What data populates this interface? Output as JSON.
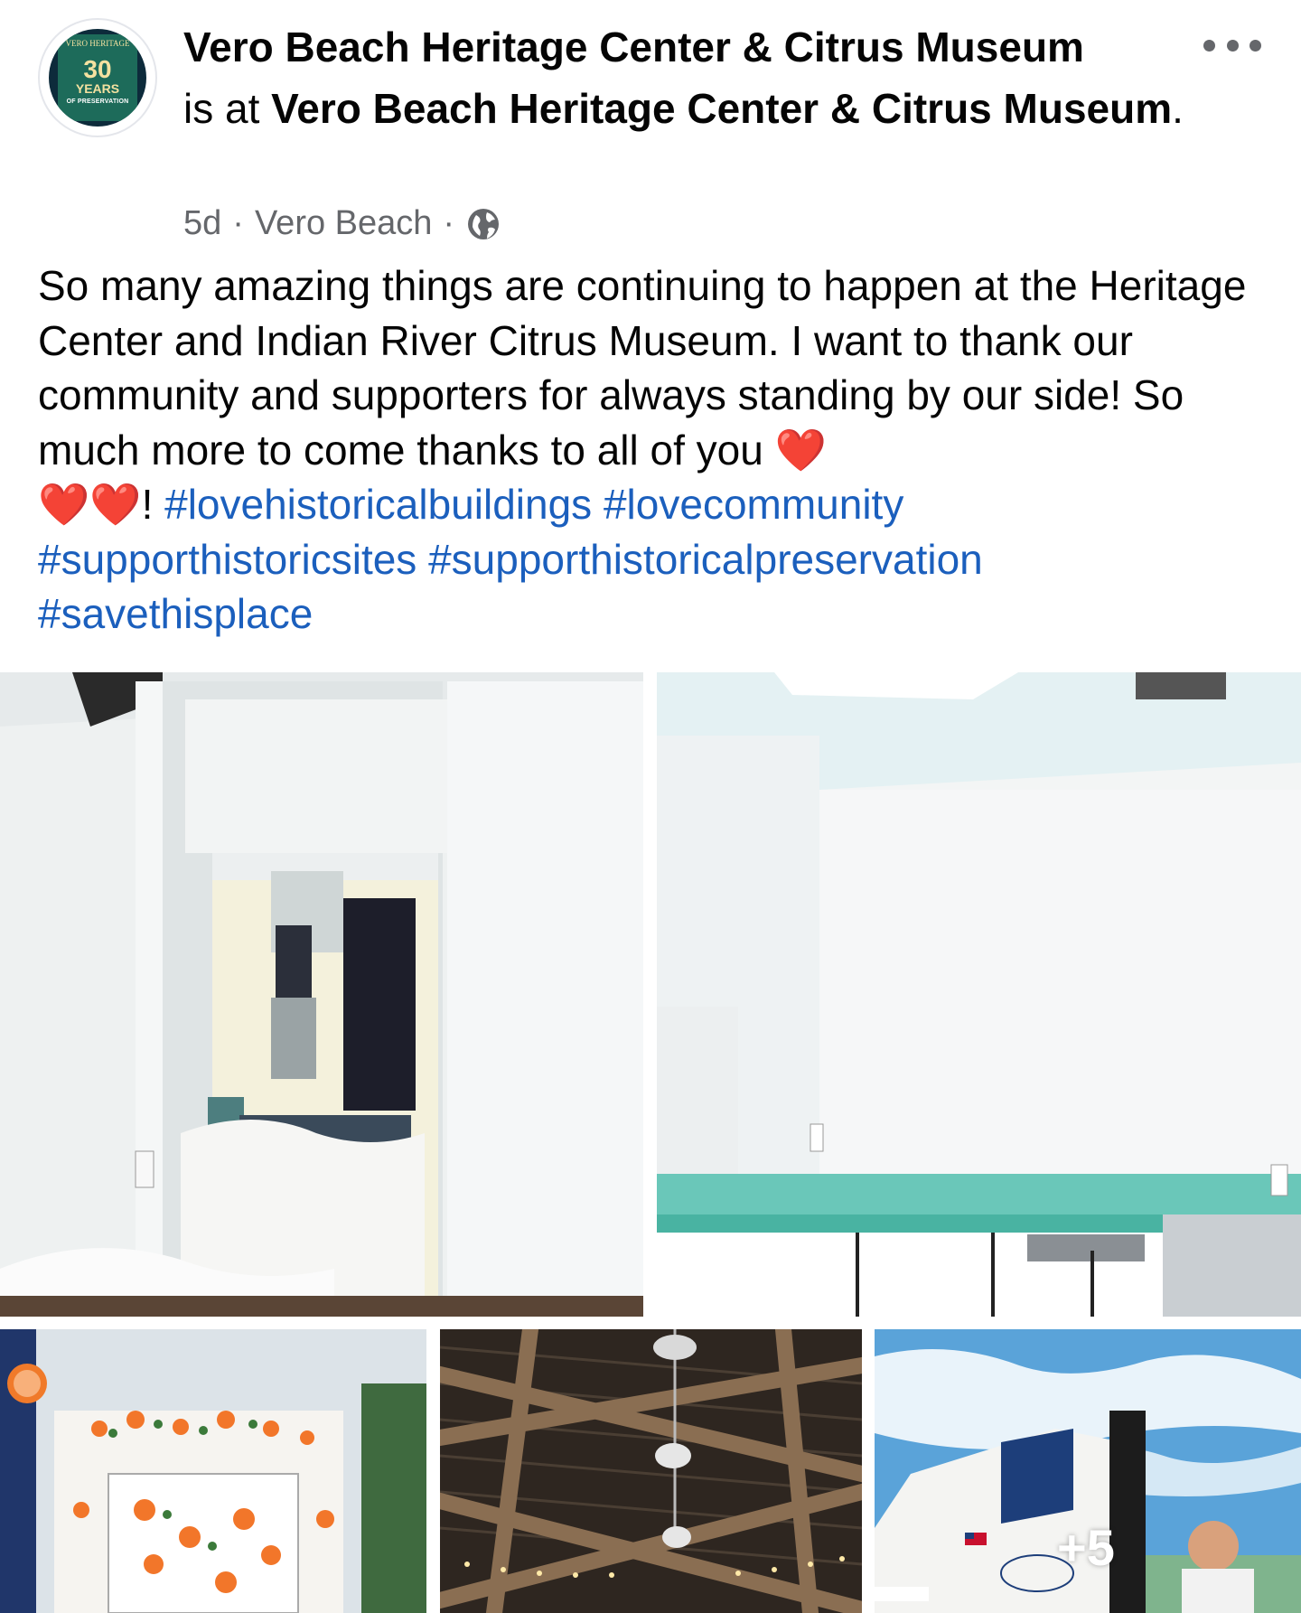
{
  "header": {
    "page_name": "Vero Beach Heritage Center & Citrus Museum",
    "is_at_text": "is at",
    "location_name": "Vero Beach Heritage Center & Citrus Museum",
    "period": ".",
    "more_icon": "more-horizontal-icon"
  },
  "avatar": {
    "logo_top": "VERO HERITAGE",
    "logo_number": "30",
    "logo_years": "YEARS",
    "logo_sub": "OF PRESERVATION"
  },
  "meta": {
    "time": "5d",
    "separator1": "·",
    "place": "Vero Beach",
    "separator2": "·",
    "audience_icon": "globe-icon"
  },
  "post": {
    "text_main": "So many amazing things are continuing to happen at the Heritage Center and Indian River Citrus Museum. I want to thank our community and supporters for always standing by our side! So much more to come thanks to all of you ",
    "heart": "❤️",
    "exclaim": "! ",
    "hashtags": [
      "#lovehistoricalbuildings",
      "#lovecommunity",
      "#supporthistoricsites",
      "#supporthistoricalpreservation",
      "#savethisplace"
    ]
  },
  "photos": {
    "more_count": "+5"
  },
  "colors": {
    "text": "#050505",
    "secondary_text": "#65676b",
    "hashtag": "#1b5fbd",
    "heart": "#e0112b"
  }
}
